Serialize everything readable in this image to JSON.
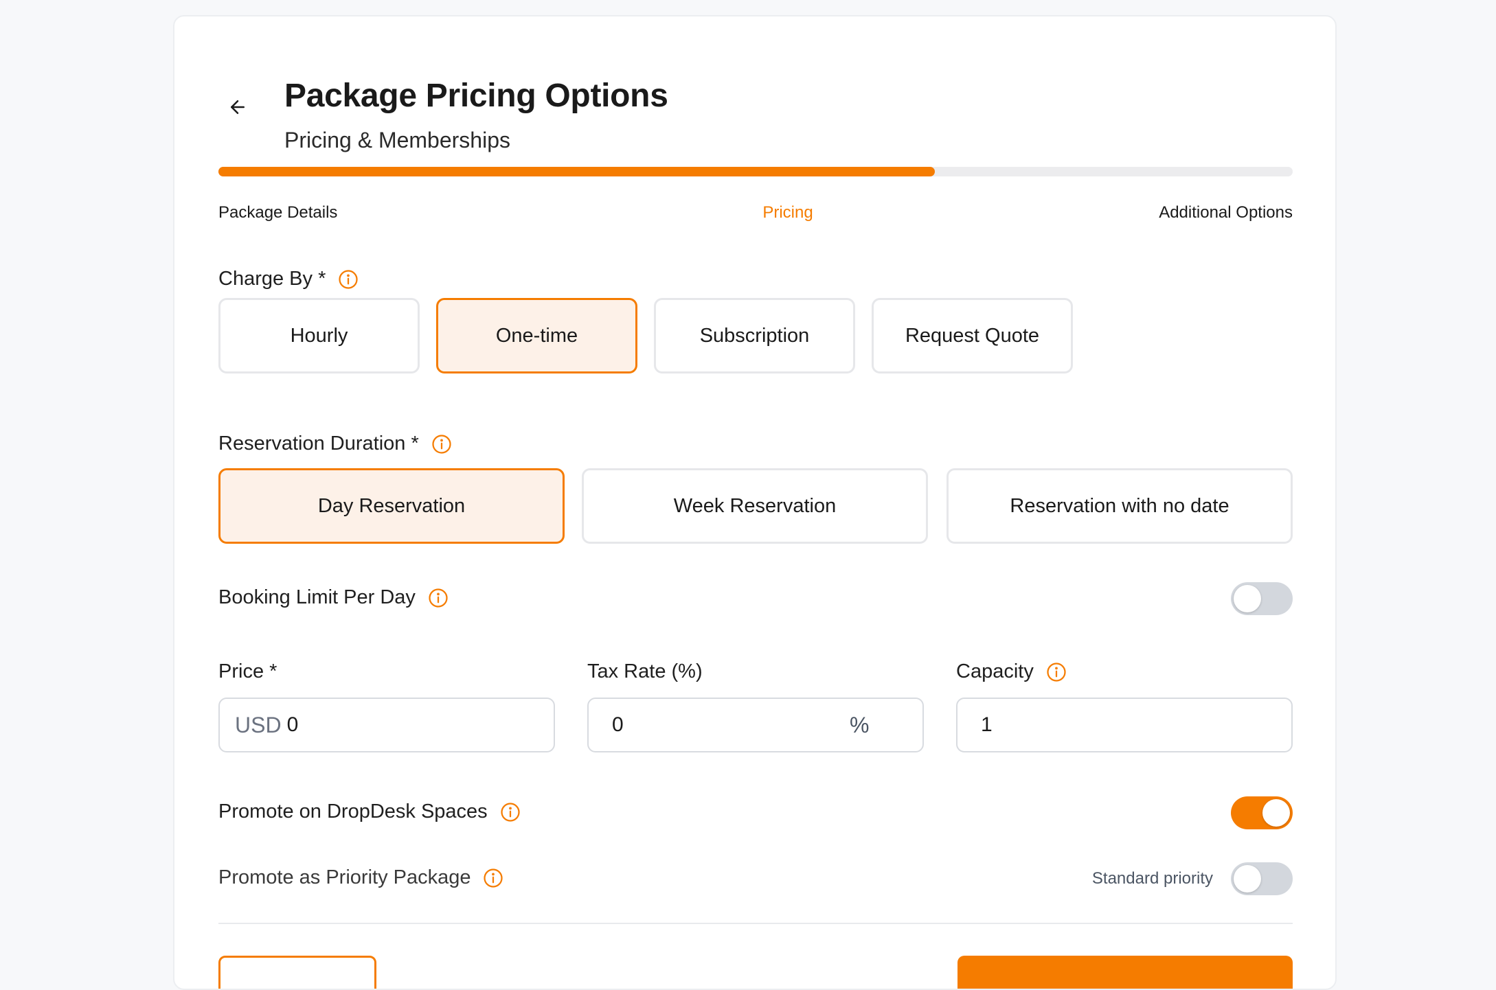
{
  "header": {
    "title": "Package Pricing Options",
    "subtitle": "Pricing & Memberships",
    "back_icon": "arrow-left-icon"
  },
  "progress": {
    "fraction": 0.667,
    "steps": [
      {
        "label": "Package Details",
        "active": false
      },
      {
        "label": "Pricing",
        "active": true
      },
      {
        "label": "Additional Options",
        "active": false
      }
    ]
  },
  "charge_by": {
    "label": "Charge By *",
    "options": [
      "Hourly",
      "One-time",
      "Subscription",
      "Request Quote"
    ],
    "selected": "One-time"
  },
  "reservation_duration": {
    "label": "Reservation Duration *",
    "options": [
      "Day Reservation",
      "Week Reservation",
      "Reservation with no date"
    ],
    "selected": "Day Reservation"
  },
  "booking_limit": {
    "label": "Booking Limit Per Day",
    "enabled": false
  },
  "price": {
    "label": "Price *",
    "prefix": "USD",
    "value": "0"
  },
  "tax_rate": {
    "label": "Tax Rate (%)",
    "value": "0",
    "suffix": "%"
  },
  "capacity": {
    "label": "Capacity",
    "value": "1"
  },
  "promote_spaces": {
    "label": "Promote on DropDesk Spaces",
    "enabled": true
  },
  "promote_priority": {
    "label": "Promote as Priority Package",
    "status": "Standard priority",
    "enabled": false
  },
  "colors": {
    "accent": "#f57c00",
    "accent_bg": "#fdf1e8",
    "toggle_off": "#d3d7dd",
    "border": "#e6e7ea"
  }
}
